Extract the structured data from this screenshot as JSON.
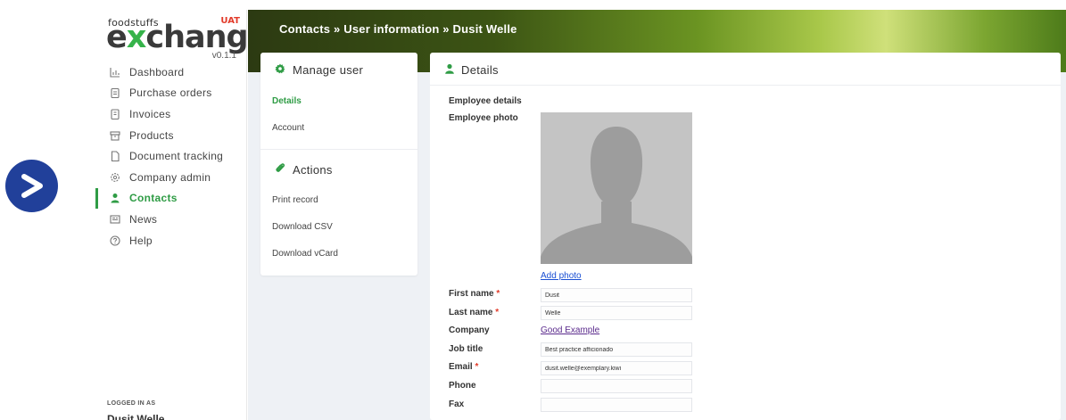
{
  "brand": {
    "small": "foodstuffs",
    "big_pre": "e",
    "big_x": "x",
    "big_post": "change",
    "env": "UAT",
    "version": "v0.1.1"
  },
  "colors": {
    "accent": "#2f9c45",
    "required": "#e23b2a",
    "link": "#1a4fd3",
    "visited_link": "#5a2a8c",
    "badge": "#21409a"
  },
  "sidebar": {
    "items": [
      {
        "label": "Dashboard",
        "icon": "bar-chart-icon"
      },
      {
        "label": "Purchase orders",
        "icon": "clipboard-icon"
      },
      {
        "label": "Invoices",
        "icon": "invoice-icon"
      },
      {
        "label": "Products",
        "icon": "box-icon"
      },
      {
        "label": "Document tracking",
        "icon": "document-icon"
      },
      {
        "label": "Company admin",
        "icon": "gear-icon"
      },
      {
        "label": "Contacts",
        "icon": "user-icon",
        "active": true
      },
      {
        "label": "News",
        "icon": "newspaper-icon"
      },
      {
        "label": "Help",
        "icon": "help-icon"
      }
    ],
    "logged_in_label": "LOGGED IN AS",
    "logged_in_name": "Dusit Welle"
  },
  "header": {
    "breadcrumb": "Contacts » User information » Dusit Welle"
  },
  "manage_user": {
    "title": "Manage user",
    "links": [
      {
        "label": "Details",
        "active": true
      },
      {
        "label": "Account"
      }
    ]
  },
  "actions": {
    "title": "Actions",
    "links": [
      {
        "label": "Print record"
      },
      {
        "label": "Download CSV"
      },
      {
        "label": "Download vCard"
      }
    ]
  },
  "details": {
    "title": "Details",
    "section_label": "Employee details",
    "photo_label": "Employee photo",
    "add_photo": "Add photo",
    "first_name_label": "First name",
    "first_name": "Dusit",
    "last_name_label": "Last name",
    "last_name": "Welle",
    "company_label": "Company",
    "company": "Good Example",
    "job_title_label": "Job title",
    "job_title": "Best practice afficionado",
    "email_label": "Email",
    "email": "dusit.welle@exemplary.kiwi",
    "phone_label": "Phone",
    "phone": "",
    "fax_label": "Fax",
    "fax": "",
    "required_mark": "*"
  }
}
